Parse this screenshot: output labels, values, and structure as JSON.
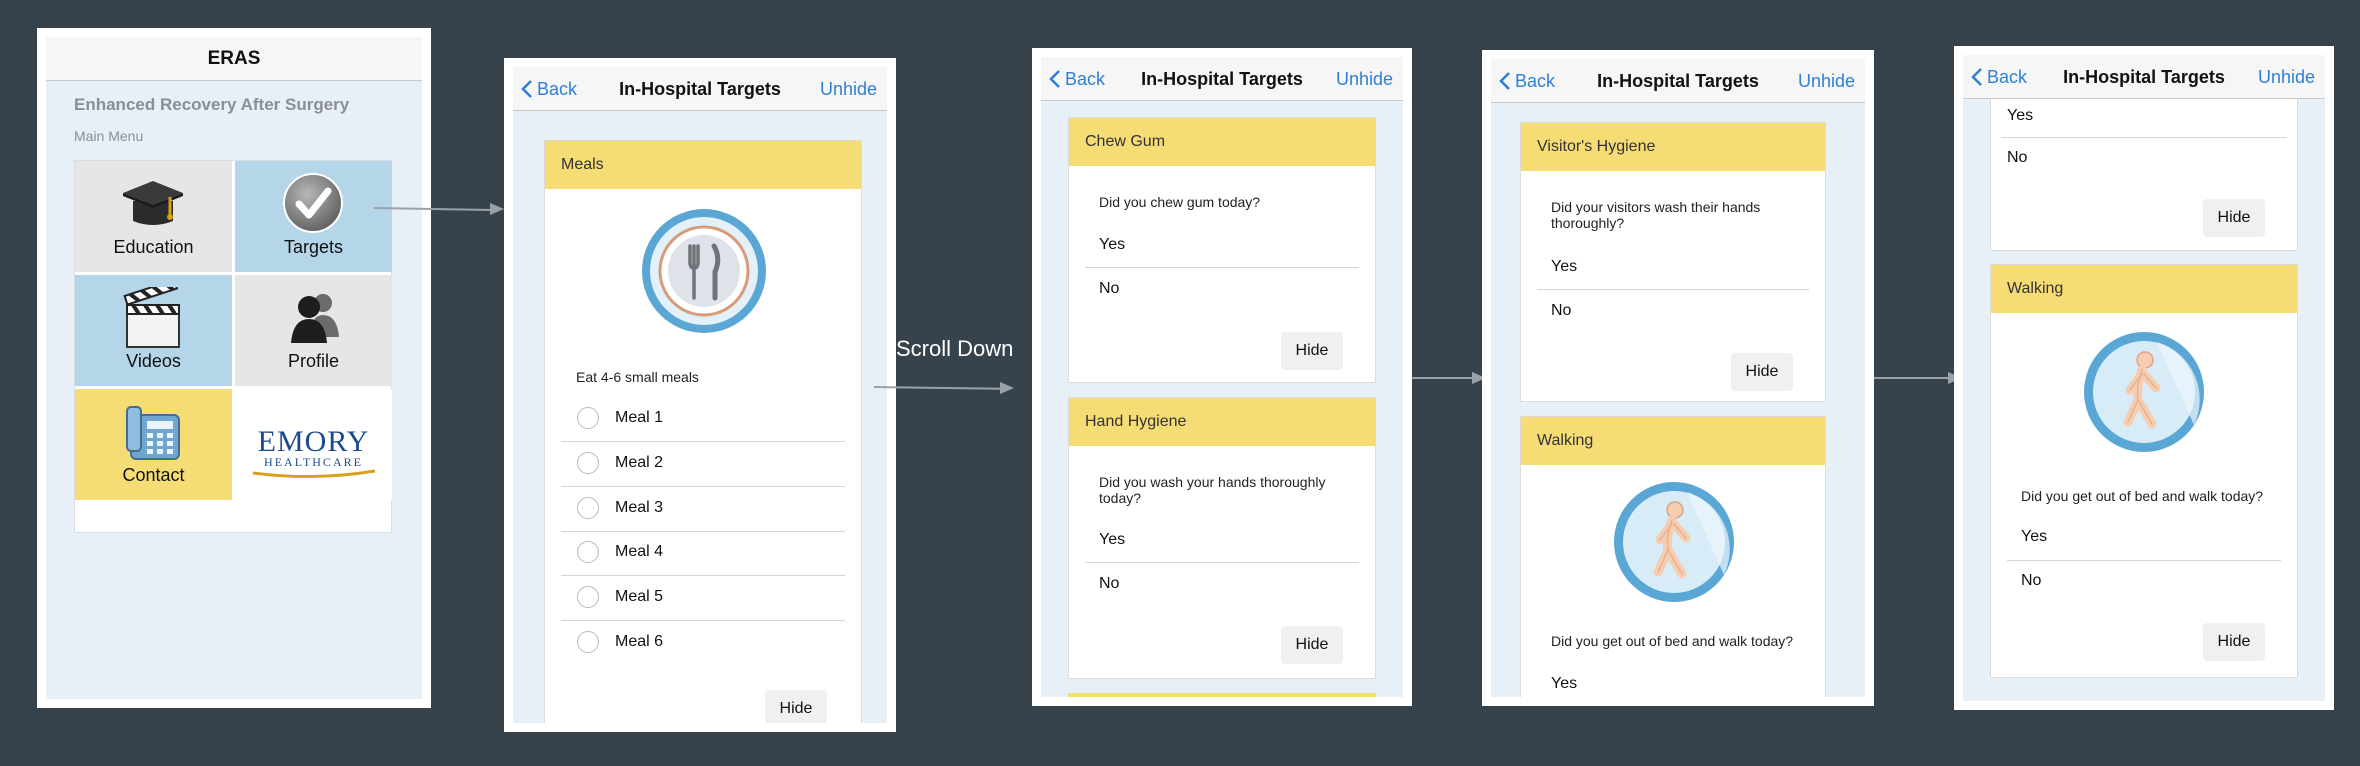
{
  "home": {
    "title": "ERAS",
    "subtitle": "Enhanced Recovery After Surgery",
    "menu_label": "Main Menu",
    "tiles": [
      {
        "label": "Education",
        "icon": "graduation-cap-icon",
        "color": "#e6e6e6"
      },
      {
        "label": "Targets",
        "icon": "checkmark-icon",
        "color": "#b5d5e8"
      },
      {
        "label": "Videos",
        "icon": "clapperboard-icon",
        "color": "#b5d5e8"
      },
      {
        "label": "Profile",
        "icon": "people-icon",
        "color": "#e6e6e6"
      },
      {
        "label": "Contact",
        "icon": "phone-icon",
        "color": "#f6dc75"
      }
    ],
    "logo": {
      "line1": "EMORY",
      "line2": "HEALTHCARE"
    }
  },
  "nav": {
    "back_label": "Back",
    "title": "In-Hospital Targets",
    "right_label": "Unhide"
  },
  "annotation": {
    "scroll_label": "Scroll Down"
  },
  "screen2": {
    "meals_card": {
      "header": "Meals",
      "icon": "plate-fork-knife-icon",
      "instruction": "Eat 4-6 small meals",
      "options": [
        "Meal 1",
        "Meal 2",
        "Meal 3",
        "Meal 4",
        "Meal 5",
        "Meal 6"
      ],
      "hide_label": "Hide"
    }
  },
  "screen3": {
    "chew_card": {
      "header": "Chew Gum",
      "question": "Did you chew gum today?",
      "yes": "Yes",
      "no": "No",
      "hide_label": "Hide"
    },
    "hand_card": {
      "header": "Hand Hygiene",
      "question": "Did you wash your hands thoroughly today?",
      "yes": "Yes",
      "no": "No",
      "hide_label": "Hide"
    }
  },
  "screen4": {
    "visitor_card": {
      "header": "Visitor's Hygiene",
      "question": "Did your visitors wash their hands thoroughly?",
      "yes": "Yes",
      "no": "No",
      "hide_label": "Hide"
    },
    "walking_card": {
      "header": "Walking",
      "icon": "walking-person-icon",
      "question": "Did you get out of bed and walk today?",
      "yes": "Yes"
    }
  },
  "screen5": {
    "prev_card": {
      "yes": "Yes",
      "no": "No",
      "hide_label": "Hide"
    },
    "walking_card": {
      "header": "Walking",
      "icon": "walking-person-icon",
      "question": "Did you get out of bed and walk today?",
      "yes": "Yes",
      "no": "No",
      "hide_label": "Hide"
    }
  },
  "colors": {
    "background": "#37434c",
    "accent_blue": "#2f7fd4",
    "card_header": "#f6dc75",
    "screen_bg": "#e7eff7"
  }
}
